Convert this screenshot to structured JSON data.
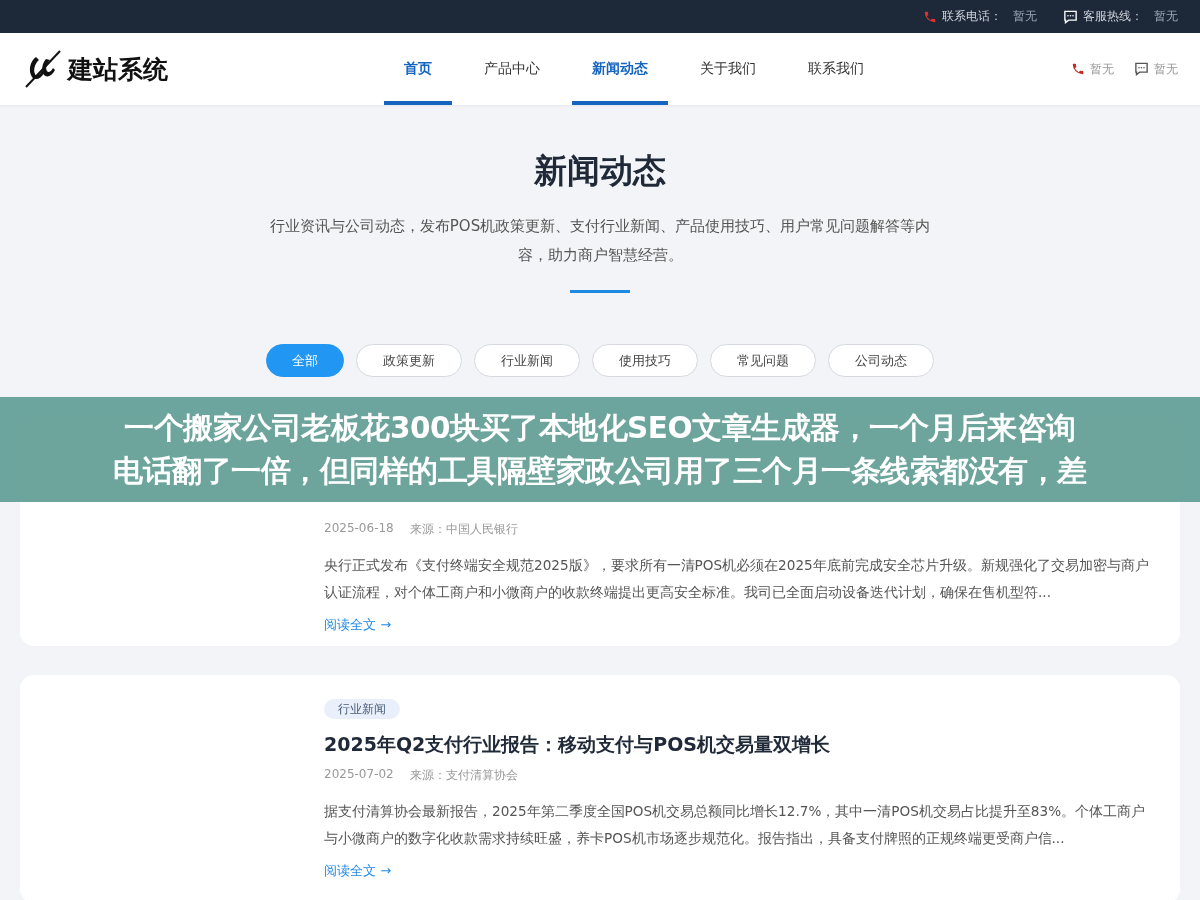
{
  "top_bar": {
    "items": [
      {
        "kind": "phone",
        "label": "联系电话：",
        "value": "暂无"
      },
      {
        "kind": "chat",
        "label": "客服热线：",
        "value": "暂无"
      }
    ]
  },
  "header": {
    "logo_text": "建站系统",
    "nav": [
      {
        "label": "首页",
        "selected": true
      },
      {
        "label": "产品中心",
        "selected": false
      },
      {
        "label": "新闻动态",
        "selected": true
      },
      {
        "label": "关于我们",
        "selected": false
      },
      {
        "label": "联系我们",
        "selected": false
      }
    ],
    "contacts": [
      {
        "kind": "phone",
        "value": "暂无"
      },
      {
        "kind": "chat",
        "value": "暂无"
      }
    ]
  },
  "hero": {
    "title": "新闻动态",
    "description": "行业资讯与公司动态，发布POS机政策更新、支付行业新闻、产品使用技巧、用户常见问题解答等内容，助力商户智慧经营。"
  },
  "filters": [
    {
      "label": "全部",
      "selected": true
    },
    {
      "label": "政策更新",
      "selected": false
    },
    {
      "label": "行业新闻",
      "selected": false
    },
    {
      "label": "使用技巧",
      "selected": false
    },
    {
      "label": "常见问题",
      "selected": false
    },
    {
      "label": "公司动态",
      "selected": false
    }
  ],
  "articles": [
    {
      "date": "2025-06-18",
      "source": "来源：中国人民银行",
      "summary": "央行正式发布《支付终端安全规范2025版》，要求所有一清POS机必须在2025年底前完成安全芯片升级。新规强化了交易加密与商户认证流程，对个体工商户和小微商户的收款终端提出更高安全标准。我司已全面启动设备迭代计划，确保在售机型符...",
      "link": "阅读全文 →"
    },
    {
      "tag": "行业新闻",
      "title": "2025年Q2支付行业报告：移动支付与POS机交易量双增长",
      "date": "2025-07-02",
      "source": "来源：支付清算协会",
      "summary": "据支付清算协会最新报告，2025年第二季度全国POS机交易总额同比增长12.7%，其中一清POS机交易占比提升至83%。个体工商户与小微商户的数字化收款需求持续旺盛，养卡POS机市场逐步规范化。报告指出，具备支付牌照的正规终端更受商户信...",
      "link": "阅读全文 →"
    }
  ],
  "caption_banner": {
    "lines": [
      "一个搬家公司老板花300块买了本地化SEO文章生成器，一个月后来咨询",
      "电话翻了一倍，但同样的工具隔壁家政公司用了三个月一条线索都没有，差"
    ]
  }
}
